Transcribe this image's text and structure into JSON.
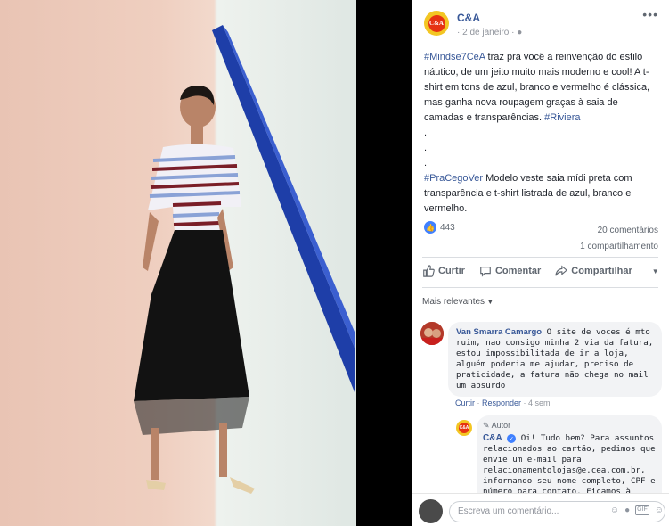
{
  "page": {
    "name": "C&A",
    "date": "2 de janeiro",
    "logo_text": "C&A"
  },
  "post": {
    "hashtag1": "#Mindse7CeA",
    "text1": " traz pra você a reinvenção do estilo náutico, de um jeito muito mais moderno e cool! A t-shirt em tons de azul, branco e vermelho é clássica, mas ganha nova roupagem graças à saia de camadas e transparências. ",
    "hashtag2": "#Riviera",
    "dots": ".",
    "hashtag3": "#PraCegoVer",
    "text2": " Modelo veste saia mídi preta com transparência e t-shirt listrada de azul, branco e vermelho."
  },
  "stats": {
    "likes": "443",
    "comments": "20 comentários",
    "shares": "1 compartilhamento"
  },
  "actions": {
    "like": "Curtir",
    "comment": "Comentar",
    "share": "Compartilhar"
  },
  "relevance": "Mais relevantes",
  "comment1": {
    "author": "Van Smarra Camargo",
    "text": " O site de voces é mto ruim, nao consigo minha 2 via da fatura, estou impossibilitada de ir a loja, alguém poderia me ajudar, preciso de praticidade, a fatura não chega no mail um absurdo",
    "like": "Curtir",
    "reply": "Responder",
    "time": "4 sem"
  },
  "comment2": {
    "badge": "Autor",
    "author": "C&A",
    "text": " Oi! Tudo bem? Para assuntos relacionados ao cartão, pedimos que envie um e-mail para relacionamentolojas@e.cea.com.br, informando seu nome completo, CPF e número para contato. Ficamos à"
  },
  "composer": {
    "placeholder": "Escreva um comentário...",
    "gif": "GIF"
  },
  "colors": {
    "link": "#385898",
    "brand_yellow": "#f3c623",
    "brand_red": "#e63312",
    "like_blue": "#4080ff"
  }
}
